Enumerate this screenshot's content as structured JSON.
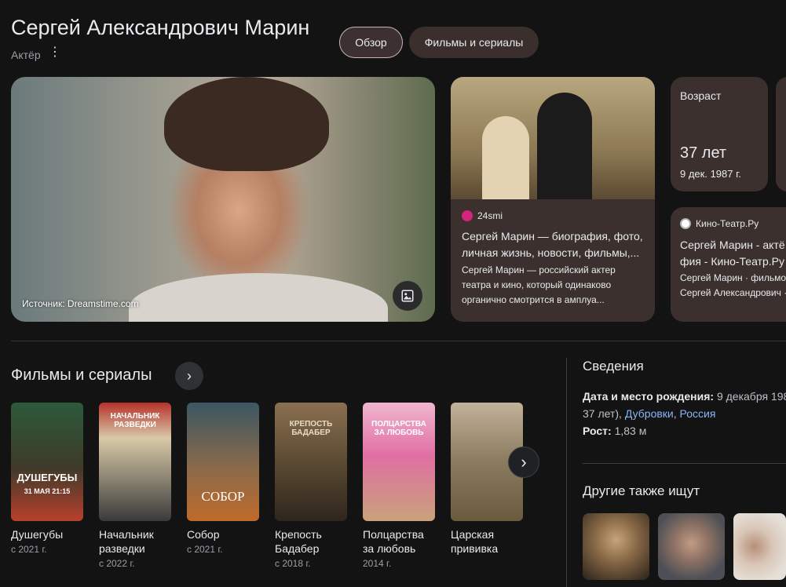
{
  "header": {
    "title": "Сергей Александрович Марин",
    "subtitle": "Актёр",
    "more_icon": "more-vert-icon",
    "tabs": [
      {
        "label": "Обзор",
        "active": true
      },
      {
        "label": "Фильмы и сериалы",
        "active": false
      }
    ]
  },
  "hero": {
    "source": "Источник: Dreamstime.com",
    "button_icon": "image-icon"
  },
  "article1": {
    "source": "24smi",
    "source_color": "#d6247d",
    "title": "Сергей Марин — биография, фото, личная жизнь, новости, фильмы,...",
    "desc": "Сергей Марин — российский актер театра и кино, который одинаково органично смотрится в амплуа..."
  },
  "age": {
    "label": "Возраст",
    "value": "37 лет",
    "date": "9 дек. 1987 г."
  },
  "article2": {
    "source": "Кино-Театр.Ру",
    "title": "Сергей Марин - актё фия - Кино-Театр.Ру",
    "desc": "Сергей Марин · фильмо Сергей Александрович ·"
  },
  "films": {
    "title": "Фильмы и сериалы",
    "more_icon": "chevron-right-icon",
    "next_icon": "chevron-right-icon",
    "items": [
      {
        "name": "Душегубы",
        "year": "с 2021 г.",
        "poster_text": "ДУШЕГУБЫ",
        "poster_sub": "31 МАЯ 21:15",
        "colors": [
          "#2c5a3a",
          "#b8402c"
        ]
      },
      {
        "name": "Начальник разведки",
        "year": "с 2022 г.",
        "poster_text": "НАЧАЛЬНИК РАЗВЕДКИ",
        "colors": [
          "#b5322a",
          "#d9c9a8"
        ]
      },
      {
        "name": "Собор",
        "year": "с 2021 г.",
        "poster_text": "СОБОР",
        "colors": [
          "#3b5663",
          "#c06a2a"
        ]
      },
      {
        "name": "Крепость Бадабер",
        "year": "с 2018 г.",
        "poster_text": "КРЕПОСТЬ БАДАБЕР",
        "colors": [
          "#5b4a33",
          "#a98a5a"
        ]
      },
      {
        "name": "Полцарства за любовь",
        "year": "2014 г.",
        "poster_text": "ПОЛЦАРСТВА ЗА ЛЮБОВЬ",
        "colors": [
          "#e06fa3",
          "#f5c3d8"
        ]
      },
      {
        "name": "Царская прививка",
        "year": "",
        "poster_text": "",
        "colors": [
          "#6a5a3e",
          "#c2b29a"
        ]
      }
    ]
  },
  "info": {
    "title": "Сведения",
    "birth_label": "Дата и место рождения:",
    "birth_value": "9 декабря 198",
    "birth_age": "37 лет),",
    "birth_city": "Дубровки",
    "birth_country": "Россия",
    "height_label": "Рост:",
    "height_value": "1,83 м"
  },
  "also": {
    "title": "Другие также ищут",
    "items": [
      {
        "colors": [
          "#5a4631",
          "#c8a47a"
        ]
      },
      {
        "colors": [
          "#4c4f56",
          "#c29a86"
        ]
      },
      {
        "colors": [
          "#e6e0d8",
          "#b88f78"
        ]
      }
    ]
  }
}
